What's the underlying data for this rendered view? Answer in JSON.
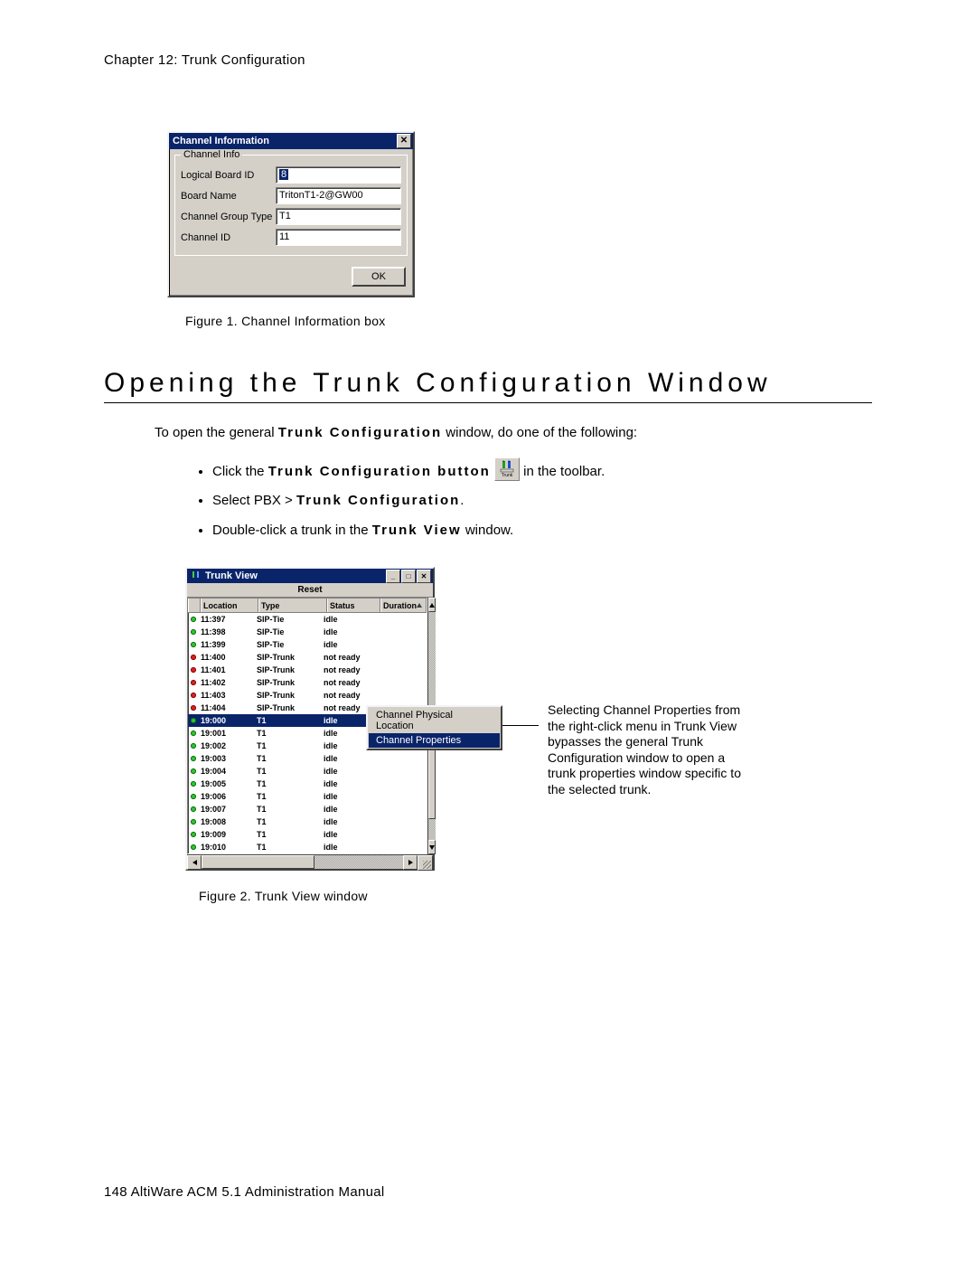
{
  "header": {
    "chapter_line": "Chapter 12:  Trunk Configuration"
  },
  "dialog1": {
    "title": "Channel Information",
    "group_legend": "Channel Info",
    "fields": {
      "logical_board_id": {
        "label": "Logical Board ID",
        "value": "8"
      },
      "board_name": {
        "label": "Board Name",
        "value": "TritonT1-2@GW00"
      },
      "channel_group": {
        "label": "Channel Group Type",
        "value": "T1"
      },
      "channel_id": {
        "label": "Channel ID",
        "value": "11"
      }
    },
    "ok": "OK"
  },
  "caption1": "Figure 1.   Channel Information box",
  "section_heading": "Opening the Trunk Configuration Window",
  "intro_text_a": "To open the general ",
  "intro_text_b": "Trunk Configuration",
  "intro_text_c": " window, do one of the following:",
  "bullets": {
    "b1a": "Click the ",
    "b1b": "Trunk Configuration button",
    "b1c": "  in the toolbar.",
    "icon_label": "Trunk",
    "b2a": "Select PBX > ",
    "b2b": "Trunk Configuration",
    "b2c": ".",
    "b3a": "Double-click a trunk in the ",
    "b3b": "Trunk View",
    "b3c": " window."
  },
  "trunkview": {
    "title": "Trunk View",
    "menu_reset": "Reset",
    "cols": {
      "location": "Location",
      "type": "Type",
      "status": "Status",
      "duration": "Duration"
    },
    "rows": [
      {
        "dot": "g",
        "loc": "11:397",
        "type": "SIP-Tie",
        "status": "idle",
        "sel": false
      },
      {
        "dot": "g",
        "loc": "11:398",
        "type": "SIP-Tie",
        "status": "idle",
        "sel": false
      },
      {
        "dot": "g",
        "loc": "11:399",
        "type": "SIP-Tie",
        "status": "idle",
        "sel": false
      },
      {
        "dot": "r",
        "loc": "11:400",
        "type": "SIP-Trunk",
        "status": "not ready",
        "sel": false
      },
      {
        "dot": "r",
        "loc": "11:401",
        "type": "SIP-Trunk",
        "status": "not ready",
        "sel": false
      },
      {
        "dot": "r",
        "loc": "11:402",
        "type": "SIP-Trunk",
        "status": "not ready",
        "sel": false
      },
      {
        "dot": "r",
        "loc": "11:403",
        "type": "SIP-Trunk",
        "status": "not ready",
        "sel": false
      },
      {
        "dot": "r",
        "loc": "11:404",
        "type": "SIP-Trunk",
        "status": "not ready",
        "sel": false
      },
      {
        "dot": "g",
        "loc": "19:000",
        "type": "T1",
        "status": "idle",
        "sel": true
      },
      {
        "dot": "g",
        "loc": "19:001",
        "type": "T1",
        "status": "idle",
        "sel": false
      },
      {
        "dot": "g",
        "loc": "19:002",
        "type": "T1",
        "status": "idle",
        "sel": false
      },
      {
        "dot": "g",
        "loc": "19:003",
        "type": "T1",
        "status": "idle",
        "sel": false
      },
      {
        "dot": "g",
        "loc": "19:004",
        "type": "T1",
        "status": "idle",
        "sel": false
      },
      {
        "dot": "g",
        "loc": "19:005",
        "type": "T1",
        "status": "idle",
        "sel": false
      },
      {
        "dot": "g",
        "loc": "19:006",
        "type": "T1",
        "status": "idle",
        "sel": false
      },
      {
        "dot": "g",
        "loc": "19:007",
        "type": "T1",
        "status": "idle",
        "sel": false
      },
      {
        "dot": "g",
        "loc": "19:008",
        "type": "T1",
        "status": "idle",
        "sel": false
      },
      {
        "dot": "g",
        "loc": "19:009",
        "type": "T1",
        "status": "idle",
        "sel": false
      },
      {
        "dot": "g",
        "loc": "19:010",
        "type": "T1",
        "status": "idle",
        "sel": false
      }
    ],
    "context_menu": {
      "item1": "Channel Physical Location",
      "item2": "Channel Properties"
    }
  },
  "annotation": "Selecting Channel Properties from the right-click menu in Trunk View bypasses the general Trunk Configuration window to open a trunk properties window specific to the selected trunk.",
  "caption2": "Figure 2.   Trunk View window",
  "footer": "148   AltiWare ACM 5.1 Administration Manual"
}
